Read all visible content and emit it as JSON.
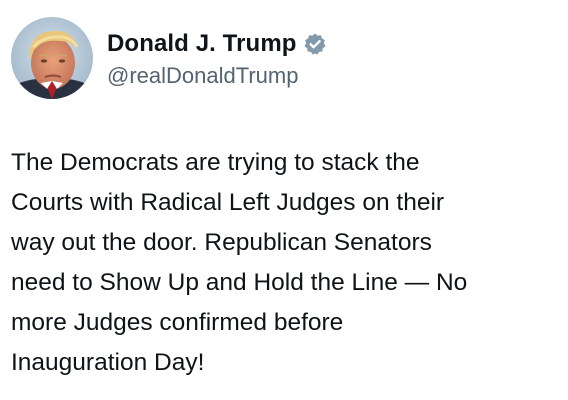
{
  "author": {
    "display_name": "Donald J. Trump",
    "handle": "@realDonaldTrump",
    "verified": true,
    "avatar_icon": "profile-photo-avatar",
    "badge_icon": "verified-badge-icon",
    "badge_color": "#829aab"
  },
  "tweet": {
    "lines": [
      "The Democrats are trying to stack the",
      "Courts with Radical Left Judges on their",
      "way out the door. Republican Senators",
      "need to Show Up and Hold the Line — No",
      "more Judges confirmed before",
      "Inauguration Day!"
    ]
  }
}
